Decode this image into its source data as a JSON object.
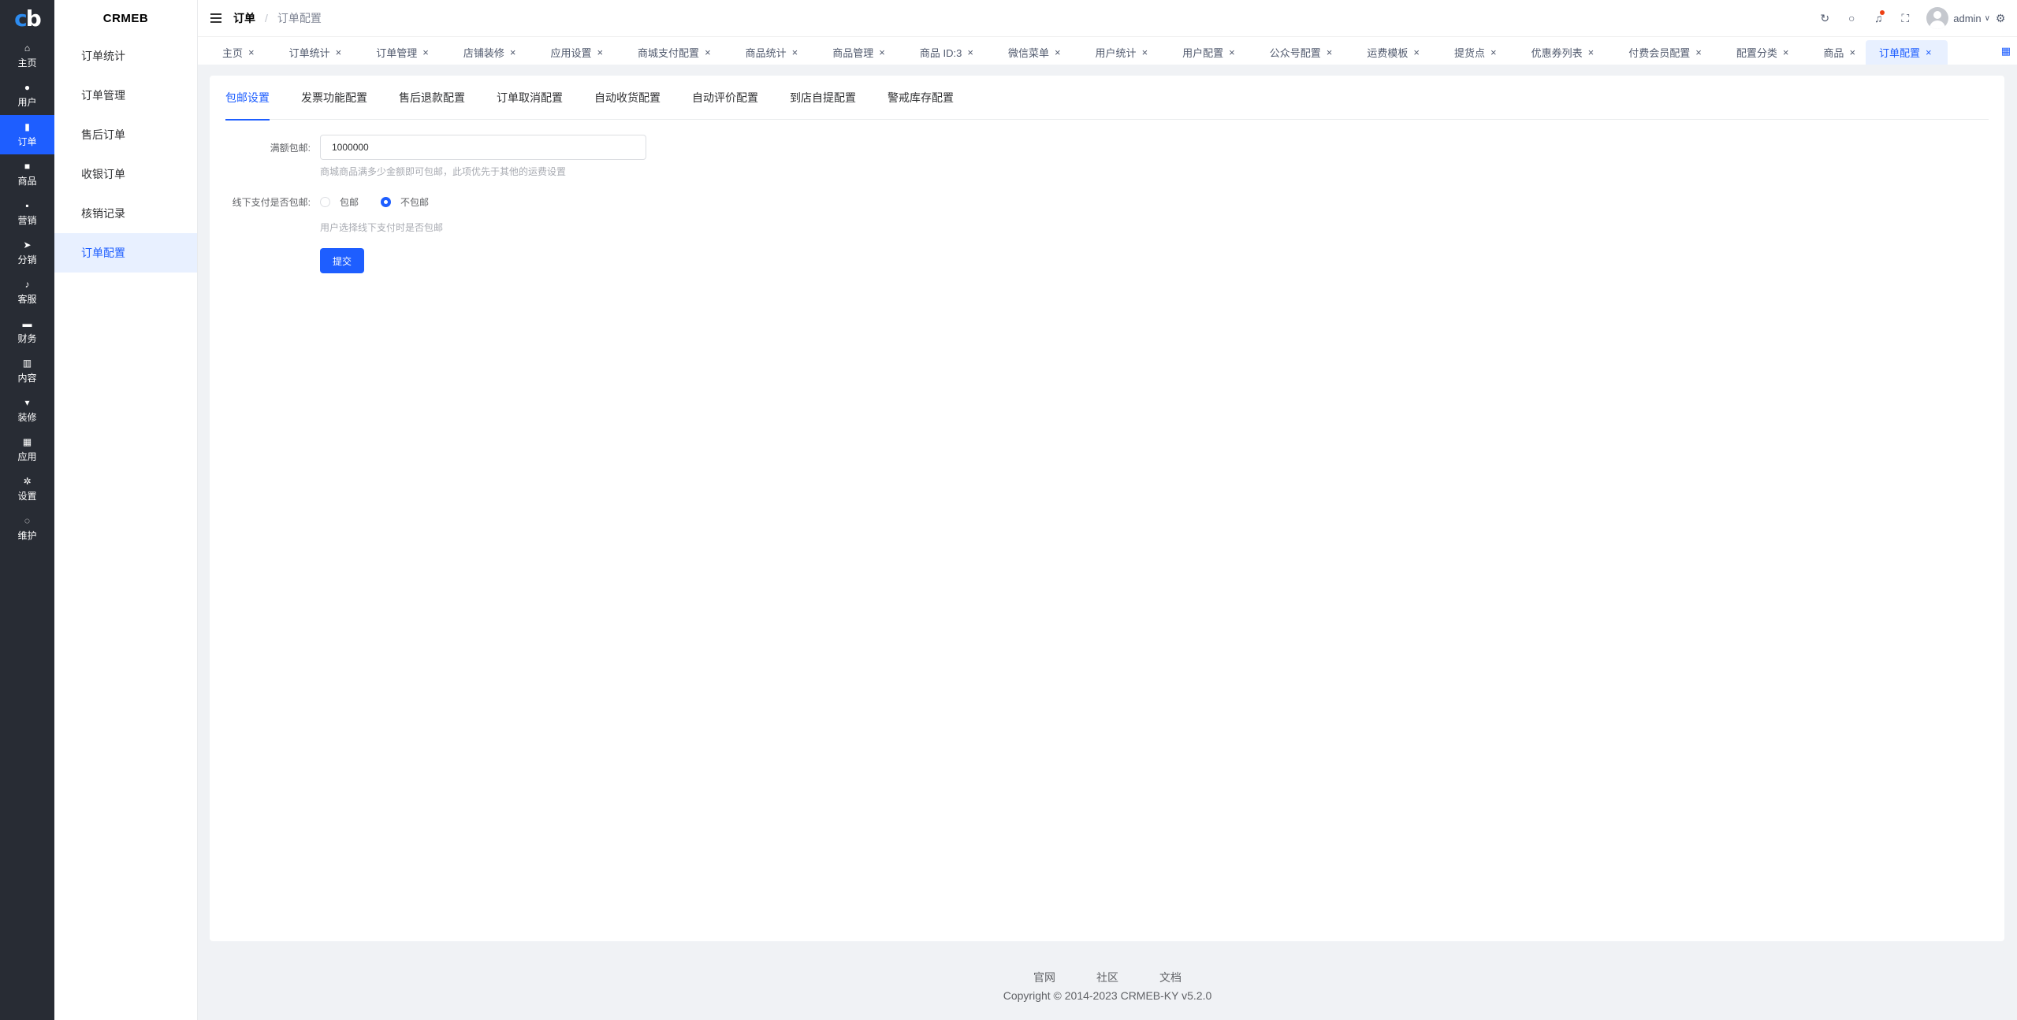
{
  "logo": {
    "text_a": "c",
    "text_b": "b"
  },
  "nav": [
    {
      "label": "主页",
      "icon": "home-icon",
      "glyph": "⌂"
    },
    {
      "label": "用户",
      "icon": "user-icon",
      "glyph": "●"
    },
    {
      "label": "订单",
      "icon": "order-icon",
      "glyph": "▮",
      "active": true
    },
    {
      "label": "商品",
      "icon": "goods-icon",
      "glyph": "■"
    },
    {
      "label": "营销",
      "icon": "marketing-icon",
      "glyph": "▪"
    },
    {
      "label": "分销",
      "icon": "distribution-icon",
      "glyph": "➤"
    },
    {
      "label": "客服",
      "icon": "service-icon",
      "glyph": "♪"
    },
    {
      "label": "财务",
      "icon": "finance-icon",
      "glyph": "▬"
    },
    {
      "label": "内容",
      "icon": "content-icon",
      "glyph": "▥"
    },
    {
      "label": "装修",
      "icon": "decorate-icon",
      "glyph": "▾"
    },
    {
      "label": "应用",
      "icon": "apps-icon",
      "glyph": "▦"
    },
    {
      "label": "设置",
      "icon": "settings-icon",
      "glyph": "✲"
    },
    {
      "label": "维护",
      "icon": "maintain-icon",
      "glyph": "◌"
    }
  ],
  "brand": "CRMEB",
  "sub_nav": [
    {
      "label": "订单统计"
    },
    {
      "label": "订单管理"
    },
    {
      "label": "售后订单"
    },
    {
      "label": "收银订单"
    },
    {
      "label": "核销记录"
    },
    {
      "label": "订单配置",
      "active": true
    }
  ],
  "header": {
    "crumb_parent": "订单",
    "crumb_sep": "/",
    "crumb_current": "订单配置",
    "user_name": "admin",
    "icons": {
      "refresh": "↻",
      "search": "○",
      "bell": "♫",
      "fullscreen": "⛶",
      "settings": "⚙",
      "caret": "∨"
    }
  },
  "tabs": [
    {
      "label": "主页"
    },
    {
      "label": "订单统计"
    },
    {
      "label": "订单管理"
    },
    {
      "label": "店铺装修"
    },
    {
      "label": "应用设置"
    },
    {
      "label": "商城支付配置"
    },
    {
      "label": "商品统计"
    },
    {
      "label": "商品管理"
    },
    {
      "label": "商品 ID:3"
    },
    {
      "label": "微信菜单"
    },
    {
      "label": "用户统计"
    },
    {
      "label": "用户配置"
    },
    {
      "label": "公众号配置"
    },
    {
      "label": "运费模板"
    },
    {
      "label": "提货点"
    },
    {
      "label": "优惠券列表"
    },
    {
      "label": "付费会员配置"
    },
    {
      "label": "配置分类"
    },
    {
      "label": "商品"
    },
    {
      "label": "订单配置",
      "active": true
    }
  ],
  "tab_close": "×",
  "tabs_more_icon": "▦",
  "config_tabs": [
    {
      "label": "包邮设置",
      "active": true
    },
    {
      "label": "发票功能配置"
    },
    {
      "label": "售后退款配置"
    },
    {
      "label": "订单取消配置"
    },
    {
      "label": "自动收货配置"
    },
    {
      "label": "自动评价配置"
    },
    {
      "label": "到店自提配置"
    },
    {
      "label": "警戒库存配置"
    }
  ],
  "form": {
    "free_shipping_label": "满额包邮:",
    "free_shipping_value": "1000000",
    "free_shipping_hint": "商城商品满多少金额即可包邮，此项优先于其他的运费设置",
    "offline_label": "线下支付是否包邮:",
    "offline_options": [
      {
        "label": "包邮",
        "checked": false
      },
      {
        "label": "不包邮",
        "checked": true
      }
    ],
    "offline_hint": "用户选择线下支付时是否包邮",
    "submit_label": "提交"
  },
  "footer": {
    "links": [
      "官网",
      "社区",
      "文档"
    ],
    "copyright": "Copyright © 2014-2023 CRMEB-KY v5.2.0"
  }
}
